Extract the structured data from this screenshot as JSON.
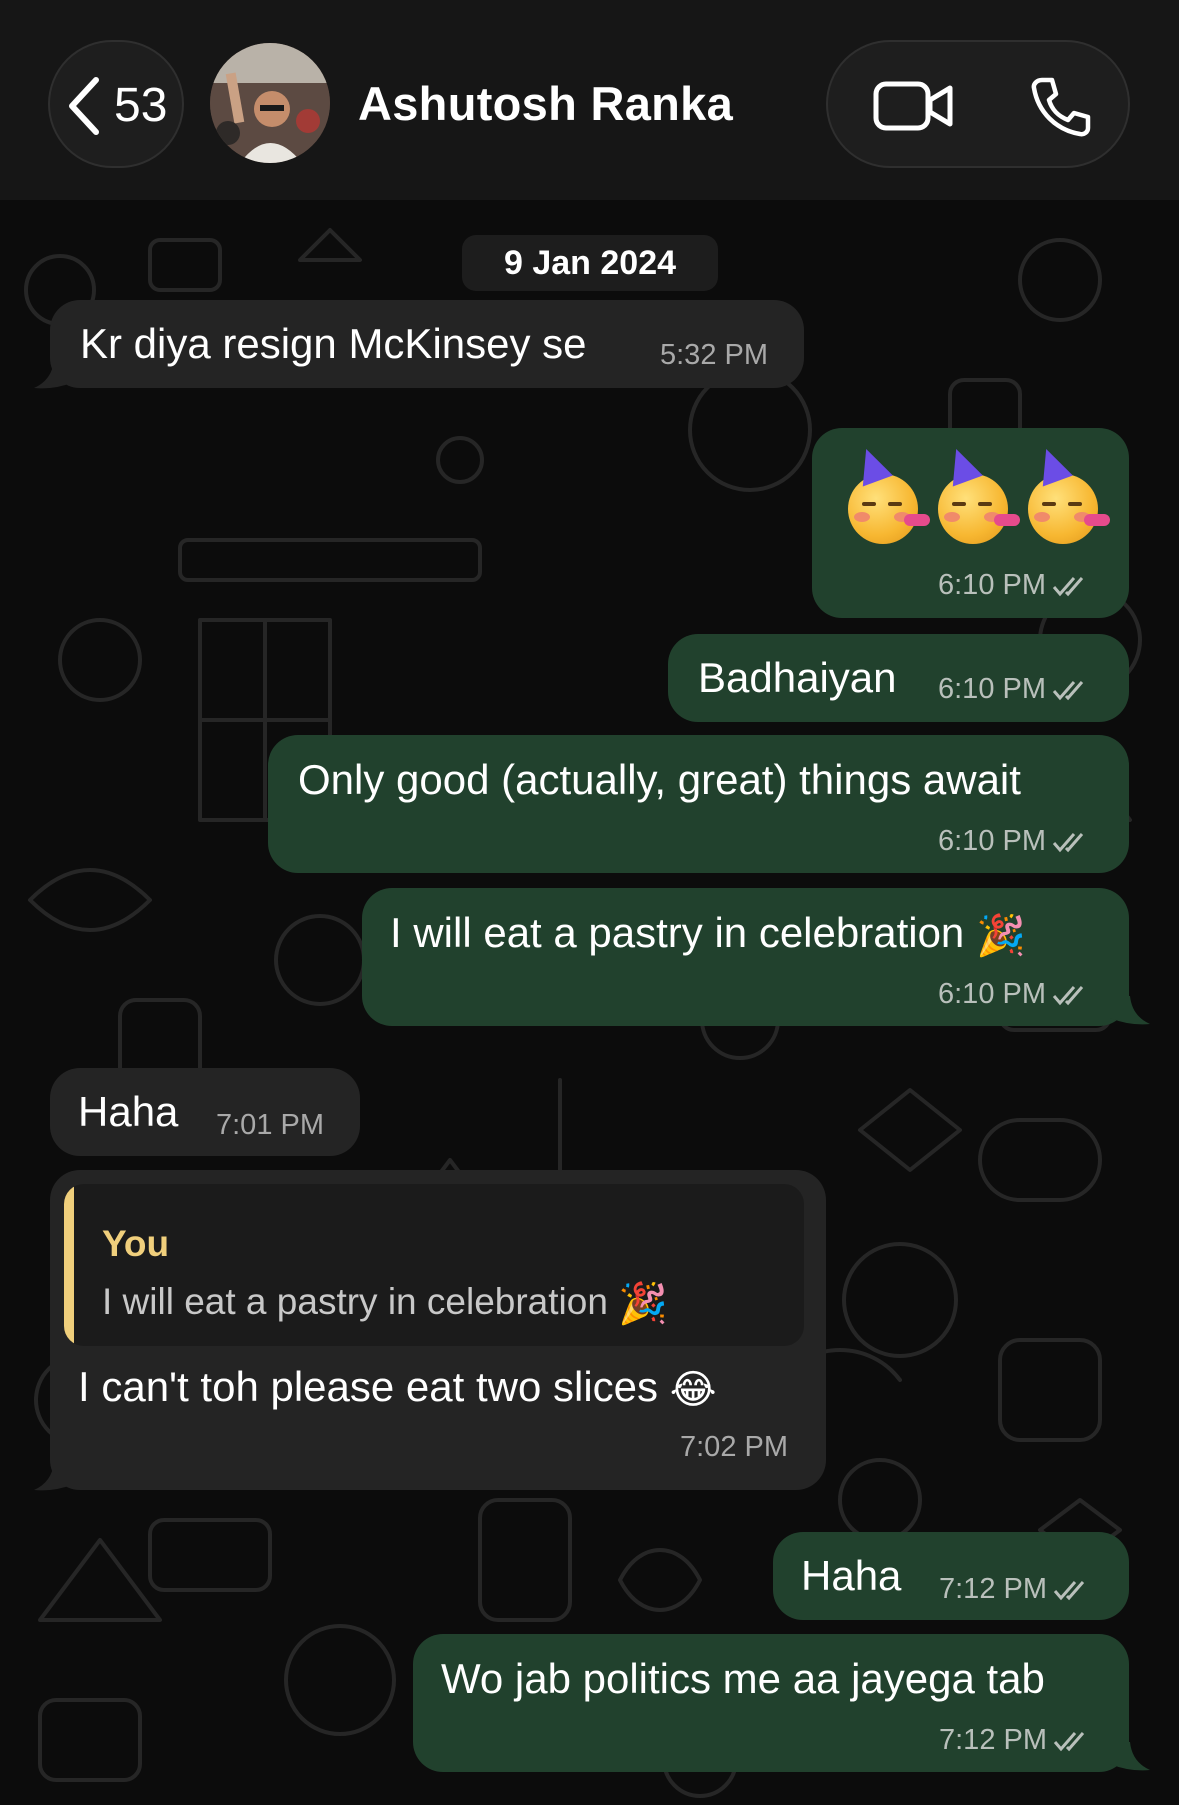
{
  "header": {
    "back_count": "53",
    "contact_name": "Ashutosh Ranka",
    "icons": [
      "chevron-left-icon",
      "video-call-icon",
      "phone-icon"
    ]
  },
  "chat": {
    "date_chip": "9 Jan 2024",
    "messages": [
      {
        "direction": "in",
        "text": "Kr diya resign McKinsey se",
        "time": "5:32 PM"
      },
      {
        "direction": "out",
        "text": "🥳🥳🥳",
        "time": "6:10 PM",
        "read": true
      },
      {
        "direction": "out",
        "text": "Badhaiyan",
        "time": "6:10 PM",
        "read": true
      },
      {
        "direction": "out",
        "text": "Only good (actually, great) things await",
        "time": "6:10 PM",
        "read": true
      },
      {
        "direction": "out",
        "text": "I will eat a pastry in celebration",
        "emoji": "🎉",
        "time": "6:10 PM",
        "read": true
      },
      {
        "direction": "in",
        "text": "Haha",
        "time": "7:01 PM"
      },
      {
        "direction": "in",
        "reply_to": {
          "author": "You",
          "text": "I will eat a pastry in celebration",
          "emoji": "🎉"
        },
        "text": "I can't toh please eat two slices",
        "emoji": "😂",
        "time": "7:02 PM"
      },
      {
        "direction": "out",
        "text": "Haha",
        "time": "7:12 PM",
        "read": true
      },
      {
        "direction": "out",
        "text": "Wo jab politics me aa jayega tab",
        "time": "7:12 PM",
        "read": true
      }
    ]
  },
  "colors": {
    "header_bg": "#161616",
    "chat_bg": "#0c0c0c",
    "incoming_bubble": "#242424",
    "outgoing_bubble": "#21412d",
    "quote_accent": "#f0cf7c",
    "meta_text": "#b9c0bb"
  }
}
